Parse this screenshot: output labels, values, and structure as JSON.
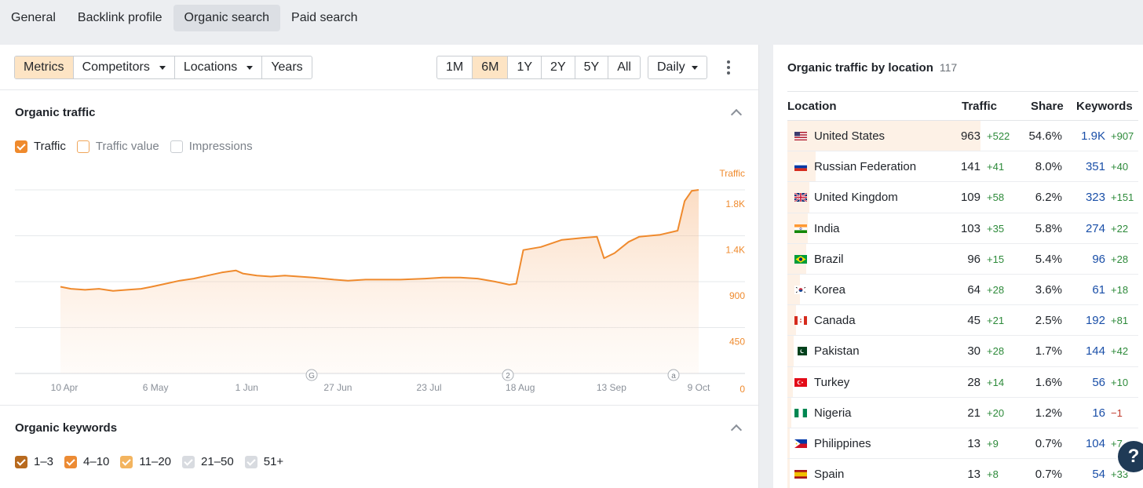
{
  "topnav": {
    "tabs": [
      {
        "label": "General"
      },
      {
        "label": "Backlink profile"
      },
      {
        "label": "Organic search",
        "active": true
      },
      {
        "label": "Paid search"
      }
    ]
  },
  "toolbar": {
    "metrics": "Metrics",
    "competitors": "Competitors",
    "locations": "Locations",
    "years": "Years",
    "ranges": [
      "1M",
      "6M",
      "1Y",
      "2Y",
      "5Y",
      "All"
    ],
    "active_range": "6M",
    "interval": "Daily"
  },
  "organic_traffic": {
    "title": "Organic traffic",
    "checks": {
      "traffic": "Traffic",
      "traffic_value": "Traffic value",
      "impressions": "Impressions"
    }
  },
  "chart_data": {
    "type": "area",
    "series_label": "Traffic",
    "color": "#ef8a2d",
    "ylim": [
      0,
      1800
    ],
    "yticks": [
      "0",
      "450",
      "900",
      "1.4K",
      "1.8K"
    ],
    "ytick_values": [
      0,
      450,
      900,
      1350,
      1800
    ],
    "xticks": [
      "10 Apr",
      "6 May",
      "1 Jun",
      "27 Jun",
      "23 Jul",
      "18 Aug",
      "13 Sep",
      "9 Oct"
    ],
    "annotations": [
      "G",
      "2",
      "a"
    ],
    "points": [
      [
        "10 Apr",
        850
      ],
      [
        "13 Apr",
        830
      ],
      [
        "17 Apr",
        820
      ],
      [
        "21 Apr",
        830
      ],
      [
        "25 Apr",
        810
      ],
      [
        "29 Apr",
        820
      ],
      [
        "3 May",
        830
      ],
      [
        "6 May",
        850
      ],
      [
        "10 May",
        880
      ],
      [
        "14 May",
        910
      ],
      [
        "18 May",
        930
      ],
      [
        "22 May",
        960
      ],
      [
        "26 May",
        990
      ],
      [
        "30 May",
        1010
      ],
      [
        "1 Jun",
        980
      ],
      [
        "5 Jun",
        960
      ],
      [
        "9 Jun",
        950
      ],
      [
        "13 Jun",
        960
      ],
      [
        "17 Jun",
        950
      ],
      [
        "21 Jun",
        940
      ],
      [
        "27 Jun",
        920
      ],
      [
        "1 Jul",
        910
      ],
      [
        "6 Jul",
        920
      ],
      [
        "11 Jul",
        920
      ],
      [
        "16 Jul",
        920
      ],
      [
        "23 Jul",
        930
      ],
      [
        "28 Jul",
        940
      ],
      [
        "2 Aug",
        940
      ],
      [
        "7 Aug",
        930
      ],
      [
        "12 Aug",
        900
      ],
      [
        "16 Aug",
        870
      ],
      [
        "18 Aug",
        880
      ],
      [
        "20 Aug",
        1210
      ],
      [
        "25 Aug",
        1240
      ],
      [
        "31 Aug",
        1310
      ],
      [
        "6 Sep",
        1330
      ],
      [
        "10 Sep",
        1340
      ],
      [
        "12 Sep",
        1130
      ],
      [
        "15 Sep",
        1180
      ],
      [
        "19 Sep",
        1290
      ],
      [
        "22 Sep",
        1340
      ],
      [
        "28 Sep",
        1360
      ],
      [
        "3 Oct",
        1400
      ],
      [
        "5 Oct",
        1690
      ],
      [
        "7 Oct",
        1790
      ],
      [
        "9 Oct",
        1800
      ]
    ]
  },
  "organic_keywords": {
    "title": "Organic keywords",
    "checks": [
      "1–3",
      "4–10",
      "11–20",
      "21–50",
      "51+"
    ]
  },
  "location_table": {
    "title": "Organic traffic by location",
    "count": "117",
    "headers": {
      "location": "Location",
      "traffic": "Traffic",
      "share": "Share",
      "keywords": "Keywords"
    },
    "rows": [
      {
        "flag": "us-flag",
        "name": "United States",
        "traffic": "963",
        "traffic_delta": "+522",
        "share": "54.6%",
        "share_value": 54.6,
        "keywords": "1.9K",
        "keywords_delta": "+907"
      },
      {
        "flag": "ru-flag",
        "name": "Russian Federation",
        "traffic": "141",
        "traffic_delta": "+41",
        "share": "8.0%",
        "share_value": 8.0,
        "keywords": "351",
        "keywords_delta": "+40"
      },
      {
        "flag": "gb-flag",
        "name": "United Kingdom",
        "traffic": "109",
        "traffic_delta": "+58",
        "share": "6.2%",
        "share_value": 6.2,
        "keywords": "323",
        "keywords_delta": "+151"
      },
      {
        "flag": "in-flag",
        "name": "India",
        "traffic": "103",
        "traffic_delta": "+35",
        "share": "5.8%",
        "share_value": 5.8,
        "keywords": "274",
        "keywords_delta": "+22"
      },
      {
        "flag": "br-flag",
        "name": "Brazil",
        "traffic": "96",
        "traffic_delta": "+15",
        "share": "5.4%",
        "share_value": 5.4,
        "keywords": "96",
        "keywords_delta": "+28"
      },
      {
        "flag": "kr-flag",
        "name": "Korea",
        "traffic": "64",
        "traffic_delta": "+28",
        "share": "3.6%",
        "share_value": 3.6,
        "keywords": "61",
        "keywords_delta": "+18"
      },
      {
        "flag": "ca-flag",
        "name": "Canada",
        "traffic": "45",
        "traffic_delta": "+21",
        "share": "2.5%",
        "share_value": 2.5,
        "keywords": "192",
        "keywords_delta": "+81"
      },
      {
        "flag": "pk-flag",
        "name": "Pakistan",
        "traffic": "30",
        "traffic_delta": "+28",
        "share": "1.7%",
        "share_value": 1.7,
        "keywords": "144",
        "keywords_delta": "+42"
      },
      {
        "flag": "tr-flag",
        "name": "Turkey",
        "traffic": "28",
        "traffic_delta": "+14",
        "share": "1.6%",
        "share_value": 1.6,
        "keywords": "56",
        "keywords_delta": "+10"
      },
      {
        "flag": "ng-flag",
        "name": "Nigeria",
        "traffic": "21",
        "traffic_delta": "+20",
        "share": "1.2%",
        "share_value": 1.2,
        "keywords": "16",
        "keywords_delta": "−1"
      },
      {
        "flag": "ph-flag",
        "name": "Philippines",
        "traffic": "13",
        "traffic_delta": "+9",
        "share": "0.7%",
        "share_value": 0.7,
        "keywords": "104",
        "keywords_delta": "+7"
      },
      {
        "flag": "es-flag",
        "name": "Spain",
        "traffic": "13",
        "traffic_delta": "+8",
        "share": "0.7%",
        "share_value": 0.7,
        "keywords": "54",
        "keywords_delta": "+33"
      }
    ]
  },
  "help": {
    "label": "?"
  }
}
